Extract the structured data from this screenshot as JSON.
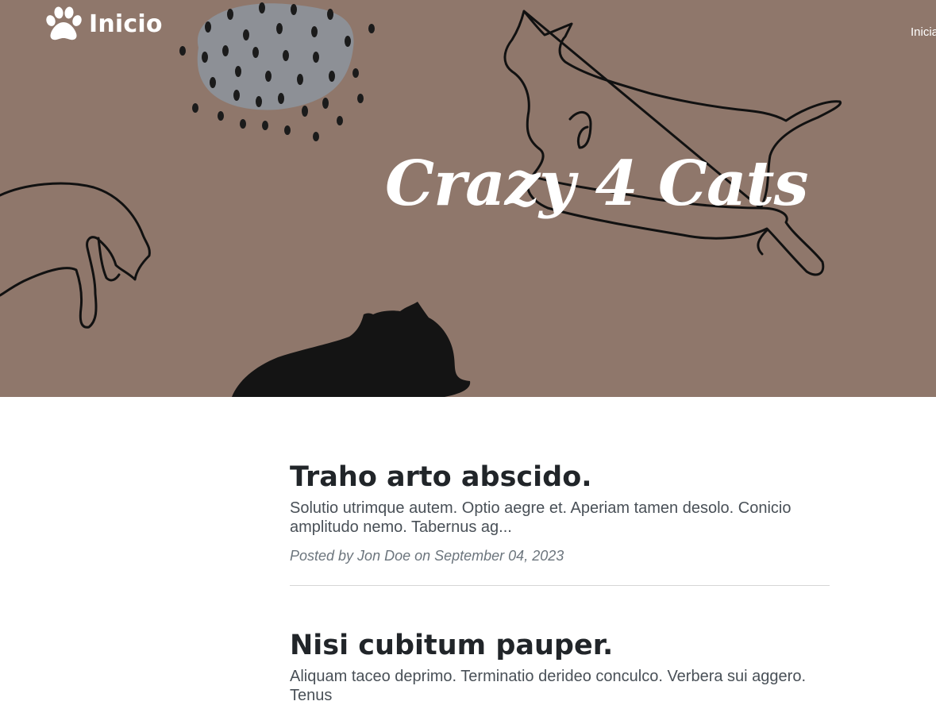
{
  "nav": {
    "brand_icon": "paw-icon",
    "brand_label": "Inicio",
    "right_link": "Inicia"
  },
  "hero": {
    "heading": "Crazy 4 Cats",
    "background_color": "#8f776b"
  },
  "posts": [
    {
      "title": "Traho arto abscido.",
      "subtitle": "Solutio utrimque autem. Optio aegre et. Aperiam tamen desolo. Conicio amplitudo nemo. Tabernus ag...",
      "meta": "Posted by Jon Doe on September 04, 2023"
    },
    {
      "title": "Nisi cubitum pauper.",
      "subtitle": "Aliquam taceo deprimo. Terminatio derideo conculco. Verbera sui aggero. Tenus"
    }
  ]
}
